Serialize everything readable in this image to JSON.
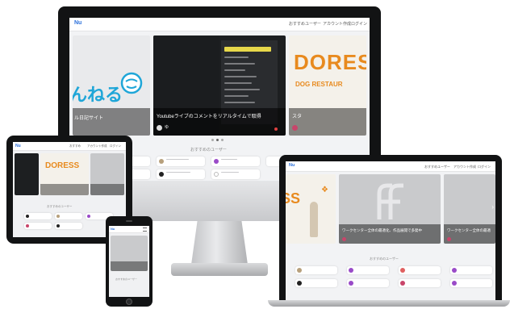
{
  "desktop": {
    "logo": "Nu",
    "nav": [
      "おすすめユーザー",
      "アカウント作成",
      "ログイン"
    ],
    "slides": [
      {
        "title": "ル日記サイト",
        "logo_text": "んねる"
      },
      {
        "title": "Youtubeライブのコメントをリアルタイムで取得",
        "user": "ゆ"
      },
      {
        "title": "スタ",
        "logo_text": "DORES",
        "sub_text": "DOG RESTAUR"
      }
    ],
    "section_title": "おすすめのユーザー"
  },
  "tablet": {
    "logo": "Nu",
    "nav": [
      "おすすめ",
      "アカウント作成",
      "ログイン"
    ],
    "slide_text": "DORESS",
    "section_title": "おすすめのユーザー"
  },
  "laptop": {
    "logo": "Nu",
    "nav": [
      "おすすめユーザー",
      "アカウント作成",
      "ログイン"
    ],
    "slide_titles": [
      "ワークセンター全体の最適化、作品展開で多発中",
      "ワークセンター全体の最適"
    ],
    "section_title": "おすすめのユーザー"
  },
  "phone": {
    "logo": "Nu",
    "section_title": "おすすめのユーザー"
  },
  "colors": {
    "bezel": "#121314",
    "accent": "#2a6fdb",
    "dores_orange": "#e88a1e",
    "mascot_blue": "#1fa6d8"
  }
}
